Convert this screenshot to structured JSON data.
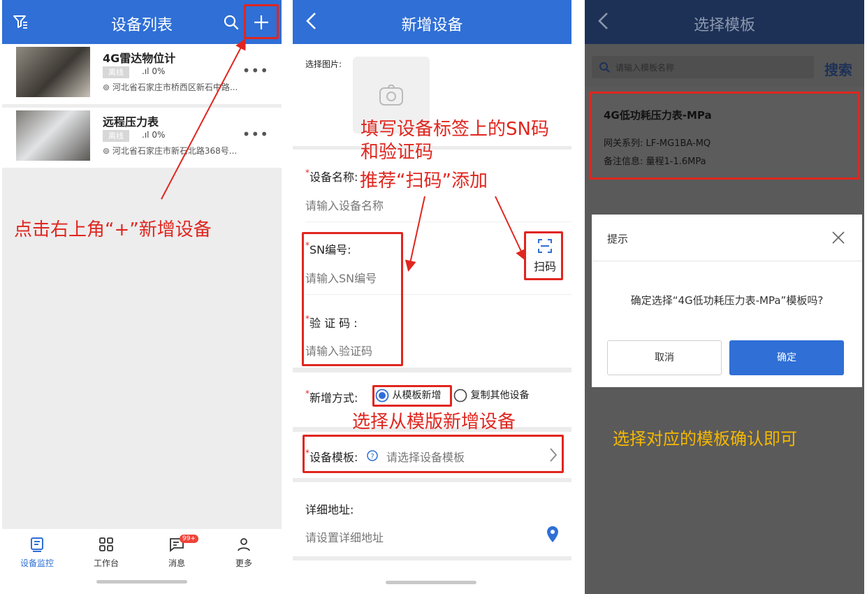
{
  "panel1": {
    "header_title": "设备列表",
    "devices": [
      {
        "name": "4G雷达物位计",
        "status": "离线",
        "signal": "0%",
        "address": "河北省石家庄市桥西区新石中路..."
      },
      {
        "name": "远程压力表",
        "status": "离线",
        "signal": "0%",
        "address": "河北省石家庄市新石北路368号..."
      }
    ],
    "annotation": "点击右上角“+”新增设备",
    "tabs": [
      {
        "label": "设备监控"
      },
      {
        "label": "工作台"
      },
      {
        "label": "消息",
        "badge": "99+"
      },
      {
        "label": "更多"
      }
    ]
  },
  "panel2": {
    "header_title": "新增设备",
    "pick_image_label": "选择图片:",
    "device_name_label": "设备名称:",
    "device_name_placeholder": "请输入设备名称",
    "sn_label": "SN编号:",
    "sn_placeholder": "请输入SN编号",
    "code_label": "验 证 码 :",
    "code_placeholder": "请输入验证码",
    "scan_label": "扫码",
    "add_mode_label": "新增方式:",
    "mode_options": [
      "从模板新增",
      "复制其他设备"
    ],
    "template_label": "设备模板:",
    "template_placeholder": "请选择设备模板",
    "address_label": "详细地址:",
    "address_placeholder": "请设置详细地址",
    "annotations": {
      "sn_line1": "填写设备标签上的SN码",
      "sn_line2": "和验证码",
      "scan": "推荐“扫码”添加",
      "template": "选择从模版新增设备"
    }
  },
  "panel3": {
    "header_title": "选择模板",
    "search_placeholder": "请输入模板名称",
    "search_button": "搜索",
    "template_name": "4G低功耗压力表-MPa",
    "gateway_line": "网关系列: LF-MG1BA-MQ",
    "remark_line": "备注信息: 量程1-1.6MPa",
    "dialog": {
      "title": "提示",
      "message": "确定选择“4G低功耗压力表-MPa”模板吗?",
      "cancel": "取消",
      "confirm": "确定"
    },
    "annotation": "选择对应的模板确认即可"
  },
  "colors": {
    "header_blue": "#2f6fd6",
    "dark_header": "#1d3157",
    "annotation_red": "#e0261f",
    "annotation_yellow": "#f5b800"
  }
}
